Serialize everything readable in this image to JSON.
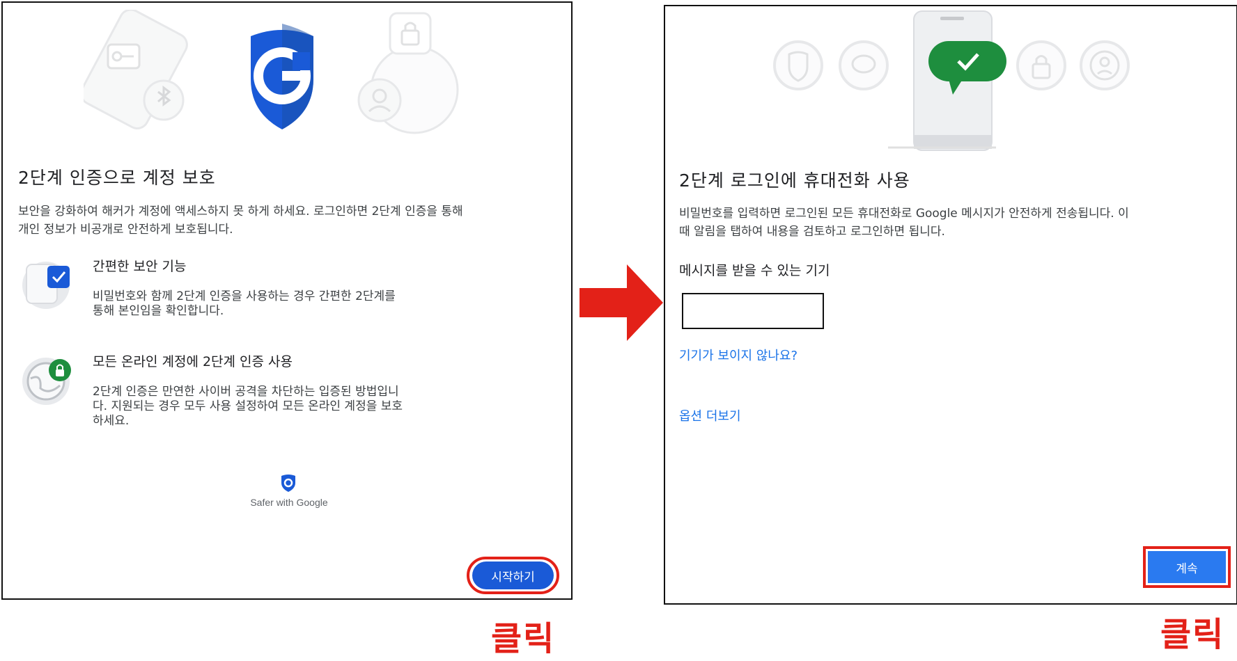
{
  "left_panel": {
    "title": "2단계 인증으로 계정 보호",
    "description_line1": "보안을 강화하여 해커가 계정에 액세스하지 못 하게 하세요. 로그인하면 2단계 인증을 통해",
    "description_line2": "개인 정보가 비공개로 안전하게 보호됩니다.",
    "feature1": {
      "title": "간편한 보안 기능",
      "desc_line1": "비밀번호와 함께 2단계 인증을 사용하는 경우 간편한 2단계를",
      "desc_line2": "통해 본인임을 확인합니다."
    },
    "feature2": {
      "title": "모든 온라인 계정에 2단계 인증 사용",
      "desc_line1": "2단계 인증은 만연한 사이버 공격을 차단하는 입증된 방법입니",
      "desc_line2": "다. 지원되는 경우 모두 사용 설정하여 모든 온라인 계정을 보호",
      "desc_line3": "하세요."
    },
    "brand_text": "Safer with Google",
    "start_button": "시작하기"
  },
  "right_panel": {
    "title": "2단계 로그인에 휴대전화 사용",
    "description_line1": "비밀번호를 입력하면 로그인된 모든 휴대전화로 Google 메시지가 안전하게 전송됩니다. 이",
    "description_line2": "때 알림을 탭하여 내용을 검토하고 로그인하면 됩니다.",
    "devices_heading": "메시지를 받을 수 있는 기기",
    "device_value": "",
    "cant_see_link": "기기가 보이지 않나요?",
    "more_options_link": "옵션 더보기",
    "continue_button": "계속"
  },
  "annotations": {
    "click_label_left": "클릭",
    "click_label_right": "클릭"
  },
  "colors": {
    "google_blue": "#1a5ad7",
    "link_blue": "#1a73e8",
    "highlight_red": "#e32118",
    "success_green": "#1e8e3e"
  }
}
